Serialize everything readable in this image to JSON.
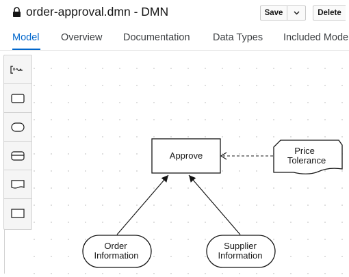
{
  "header": {
    "title": "order-approval.dmn - DMN",
    "save_label": "Save",
    "delete_label": "Delete"
  },
  "tabs": [
    {
      "label": "Model",
      "active": true
    },
    {
      "label": "Overview",
      "active": false
    },
    {
      "label": "Documentation",
      "active": false
    },
    {
      "label": "Data Types",
      "active": false
    },
    {
      "label": "Included Models",
      "active": false
    }
  ],
  "palette": [
    {
      "tool": "text-annotation",
      "icon": "text-annotation-icon"
    },
    {
      "tool": "decision",
      "icon": "decision-icon"
    },
    {
      "tool": "input-data",
      "icon": "input-data-icon"
    },
    {
      "tool": "business-knowledge-model",
      "icon": "bkm-icon"
    },
    {
      "tool": "knowledge-source",
      "icon": "knowledge-source-icon"
    },
    {
      "tool": "decision-service",
      "icon": "decision-service-icon"
    }
  ],
  "diagram": {
    "decision": {
      "label": "Approve"
    },
    "knowledge_source": {
      "line1": "Price",
      "line2": "Tolerance"
    },
    "input_order": {
      "line1": "Order",
      "line2": "Information"
    },
    "input_supplier": {
      "line1": "Supplier",
      "line2": "Information"
    }
  },
  "colors": {
    "accent": "#0066cc",
    "text": "#151515",
    "grid_dot": "#c7c7c7"
  }
}
